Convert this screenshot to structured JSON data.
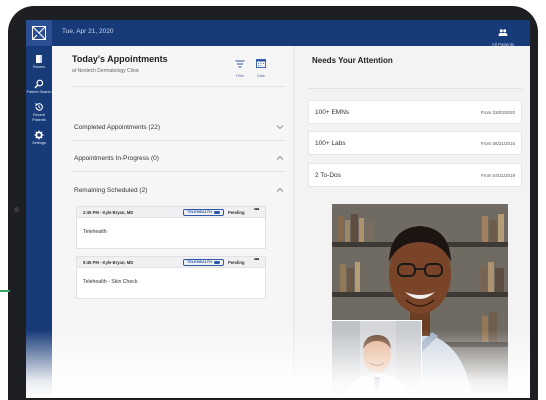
{
  "topbar": {
    "date": "Tue, Apr 21, 2020",
    "patients_label": "All Patients"
  },
  "sidebar": {
    "items": [
      {
        "label": "Rooms",
        "icon": "rooms-icon"
      },
      {
        "label": "Patient Search",
        "icon": "search-icon"
      },
      {
        "label": "Recent Patients",
        "icon": "history-icon"
      },
      {
        "label": "Settings",
        "icon": "gear-icon"
      }
    ]
  },
  "appointments": {
    "title": "Today's Appointments",
    "subtitle": "at Nextech Dermatology Clinic",
    "filter_label": "Filter",
    "date_label": "Date",
    "sections": [
      {
        "label": "Completed Appointments (22)",
        "expanded": false
      },
      {
        "label": "Appointments In-Progress (0)",
        "expanded": true
      },
      {
        "label": "Remaining Scheduled (2)",
        "expanded": true
      }
    ],
    "cards": [
      {
        "time": "2:45 PM - Kyle Bryan, MD",
        "badge": "TELEHEALTH",
        "status": "Pending",
        "more": "•••",
        "description": "Telehealth"
      },
      {
        "time": "9:45 PM - Kyle Bryan, MD",
        "badge": "TELEHEALTH",
        "status": "Pending",
        "more": "•••",
        "description": "Telehealth - Skin Check"
      }
    ]
  },
  "attention": {
    "title": "Needs Your Attention",
    "items": [
      {
        "label": "100+ EMNs",
        "date": "From 03/03/2020"
      },
      {
        "label": "100+ Labs",
        "date": "From 08/21/2015"
      },
      {
        "label": "2 To-Dos",
        "date": "From 04/11/2019"
      }
    ]
  },
  "colors": {
    "nav": "#173a78",
    "accent": "#2d57a8"
  }
}
